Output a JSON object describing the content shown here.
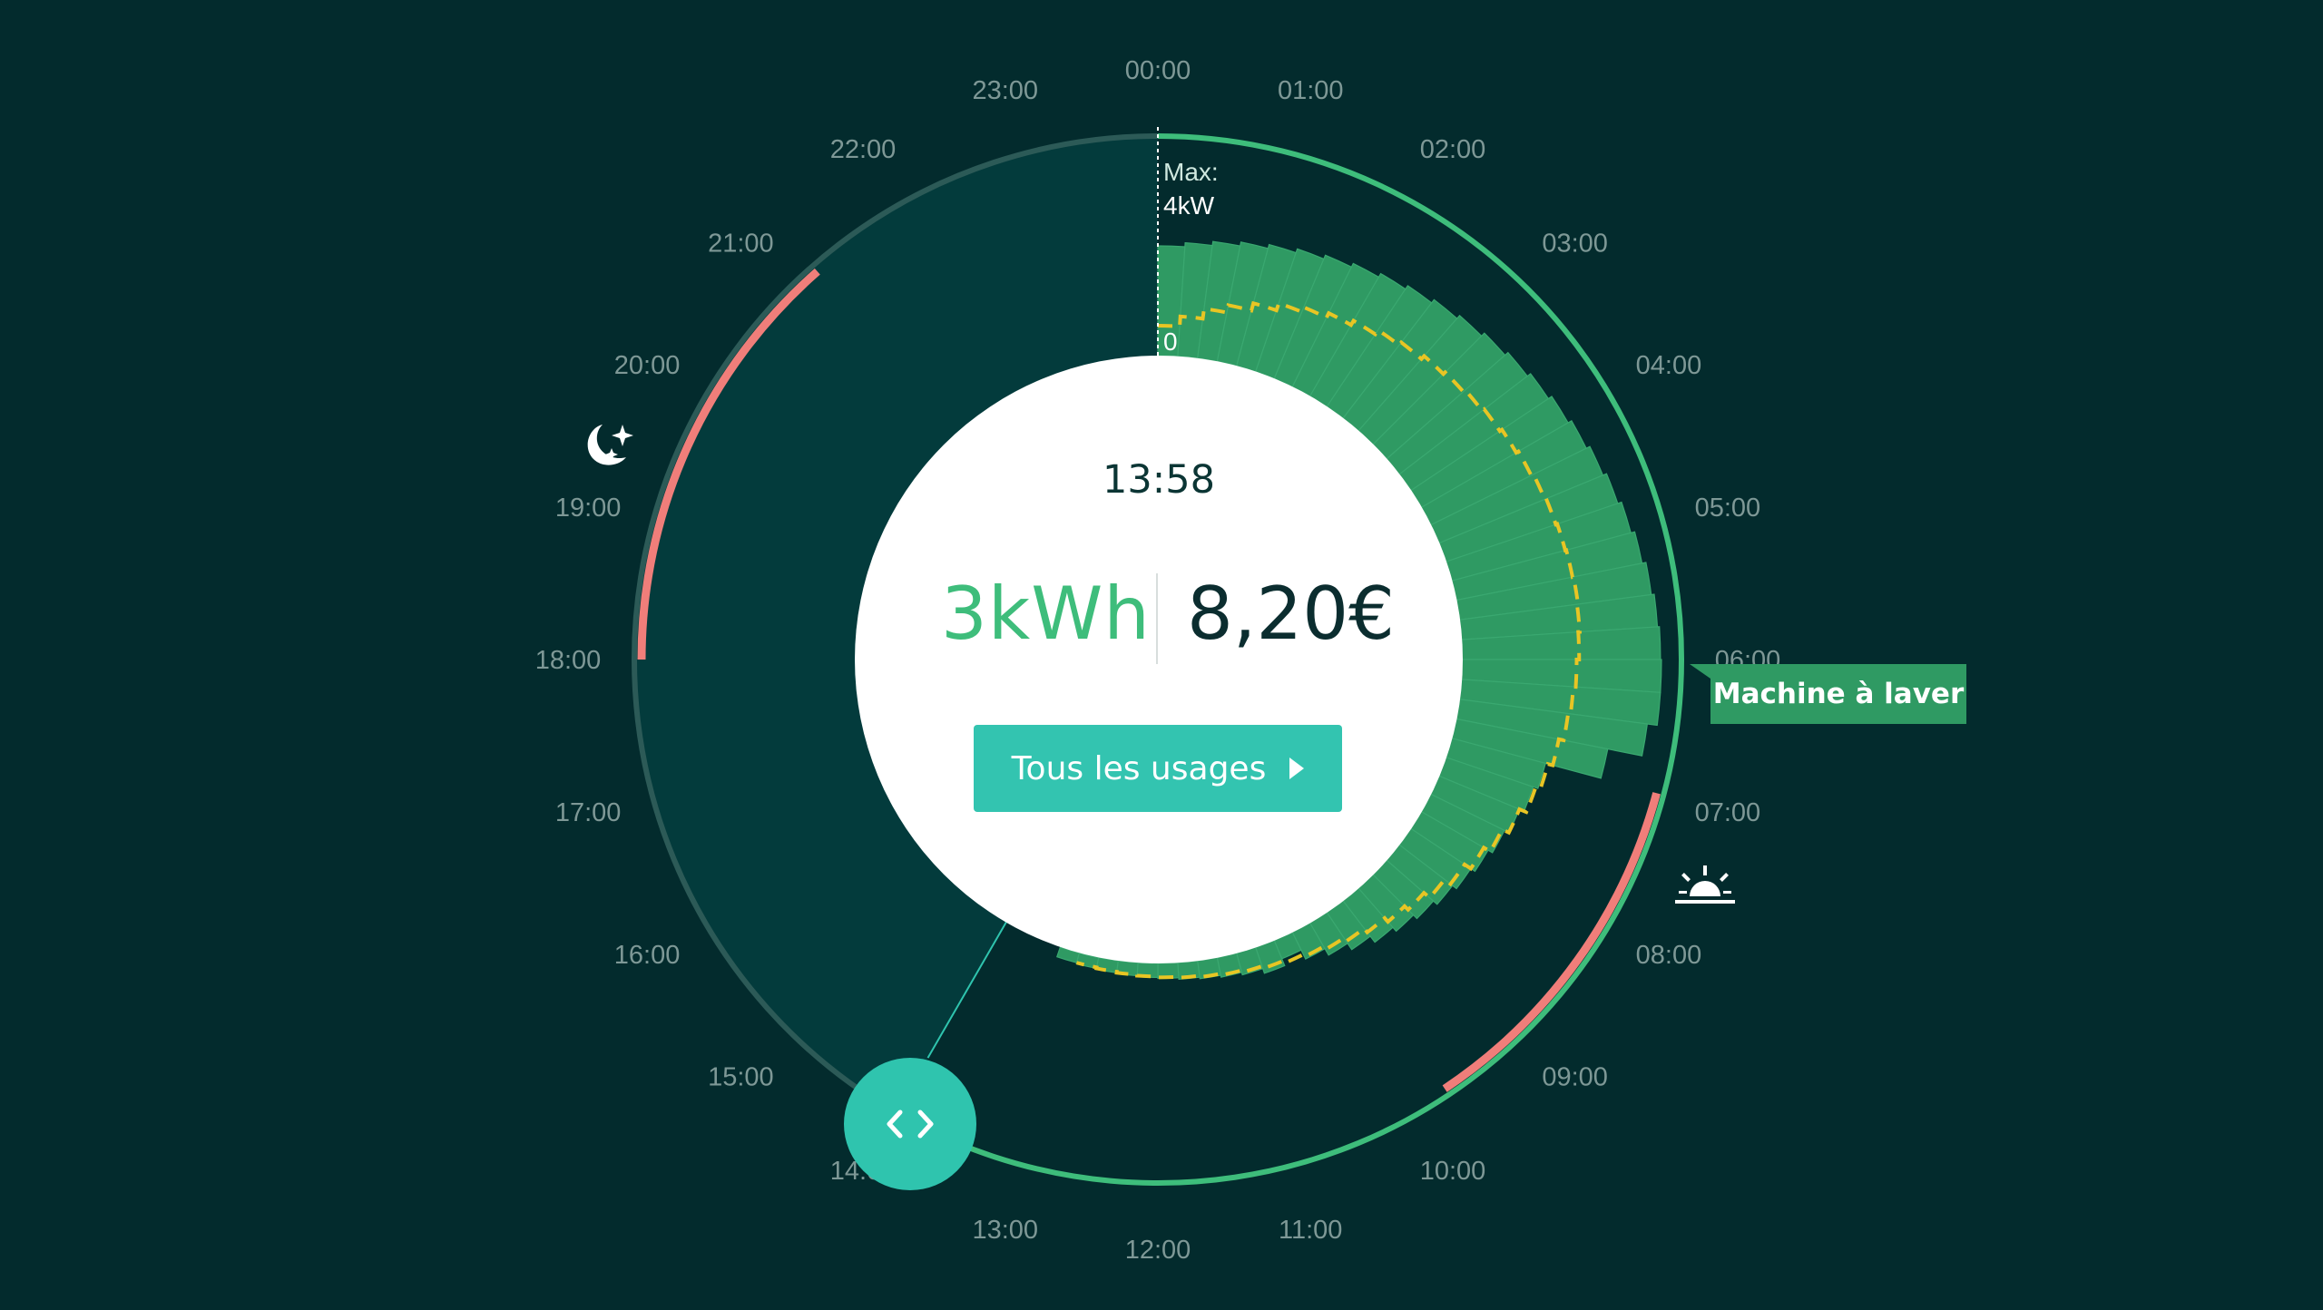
{
  "center": {
    "time": "13:58",
    "energy": "3kWh",
    "cost": "8,20€",
    "button_label": "Tous les usages"
  },
  "max_label": "Max:\n4kW",
  "zero_label": "0",
  "device_label": "Machine à laver",
  "hour_labels": [
    "00:00",
    "01:00",
    "02:00",
    "03:00",
    "04:00",
    "05:00",
    "06:00",
    "07:00",
    "08:00",
    "09:00",
    "10:00",
    "11:00",
    "12:00",
    "13:00",
    "14:00",
    "15:00",
    "16:00",
    "17:00",
    "18:00",
    "19:00",
    "20:00",
    "21:00",
    "22:00",
    "23:00"
  ],
  "icons": {
    "night": "moon-stars-icon",
    "morning": "sunrise-icon",
    "handle": "chevron-left-right-icon"
  },
  "colors": {
    "background": "#032b2d",
    "bars": "#2f9a63",
    "ring_active": "#3ebd7b",
    "ring_inactive": "#2c5a57",
    "peak_hours": "#f07e7a",
    "reference_line": "#e8c524",
    "accent": "#33c4b0",
    "energy_text": "#3ebd7b"
  },
  "chart_data": {
    "type": "bar",
    "title": "",
    "x_label": "",
    "y_label": "",
    "max_kw": 4,
    "interval_minutes": 15,
    "start_time": "00:00",
    "values": [
      2.2,
      2.28,
      2.36,
      2.44,
      2.52,
      2.6,
      2.68,
      2.76,
      2.84,
      2.92,
      3.0,
      3.08,
      3.16,
      3.24,
      3.32,
      3.4,
      3.48,
      3.56,
      3.64,
      3.72,
      3.8,
      3.88,
      3.94,
      3.98,
      4.0,
      4.0,
      3.8,
      3.1,
      1.95,
      1.85,
      1.75,
      1.65,
      1.55,
      1.45,
      1.35,
      1.25,
      1.15,
      1.05,
      0.9,
      0.75,
      0.6,
      0.4,
      0.55,
      0.45,
      0.4,
      0.36,
      0.33,
      0.3,
      0.28,
      0.26,
      0.24,
      0.22,
      0.2
    ],
    "reference_values": [
      0.6,
      0.8,
      1.0,
      1.15,
      1.3,
      1.45,
      1.55,
      1.65,
      1.75,
      1.85,
      1.92,
      2.0,
      2.05,
      2.1,
      2.15,
      2.2,
      2.25,
      2.3,
      2.33,
      2.36,
      2.38,
      2.4,
      2.38,
      2.35,
      2.3,
      2.25,
      2.2,
      2.1,
      2.0,
      1.9,
      1.75,
      1.6,
      1.45,
      1.3,
      1.15,
      1.0,
      0.9,
      0.8,
      0.7,
      0.62,
      0.55,
      0.5,
      0.45,
      0.4,
      0.36,
      0.33,
      0.3,
      0.28,
      0.26,
      0.24,
      0.22,
      0.2
    ],
    "peak_ranges": [
      [
        "18:00",
        "21:15"
      ],
      [
        "07:00",
        "09:45"
      ]
    ]
  }
}
